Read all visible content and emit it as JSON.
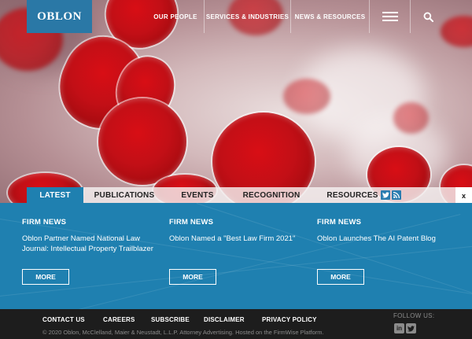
{
  "header": {
    "logo": "OBLON",
    "nav": [
      "OUR PEOPLE",
      "SERVICES & INDUSTRIES",
      "NEWS & RESOURCES"
    ]
  },
  "tabs": {
    "items": [
      "LATEST",
      "PUBLICATIONS",
      "EVENTS",
      "RECOGNITION",
      "RESOURCES"
    ],
    "active": "LATEST",
    "close": "x"
  },
  "news": [
    {
      "category": "FIRM NEWS",
      "title": "Oblon Partner Named National Law Journal: Intellectual Property Trailblazer",
      "more": "MORE"
    },
    {
      "category": "FIRM NEWS",
      "title": "Oblon Named a \"Best Law Firm 2021\"",
      "more": "MORE"
    },
    {
      "category": "FIRM NEWS",
      "title": "Oblon Launches The AI Patent Blog",
      "more": "MORE"
    }
  ],
  "footer": {
    "links": [
      "CONTACT US",
      "CAREERS",
      "SUBSCRIBE",
      "DISCLAIMER",
      "PRIVACY POLICY"
    ],
    "copyright": "© 2020 Oblon, McClelland, Maier & Neustadt, L.L.P. Attorney Advertising. Hosted on the FirmWise Platform.",
    "follow_label": "FOLLOW US:",
    "social": [
      "linkedin-icon",
      "twitter-icon"
    ]
  },
  "colors": {
    "brand_blue": "#1f80b0",
    "logo_blue": "#2a78a6",
    "footer_bg": "#1d1d1d",
    "cell_red": "#c20f16"
  }
}
